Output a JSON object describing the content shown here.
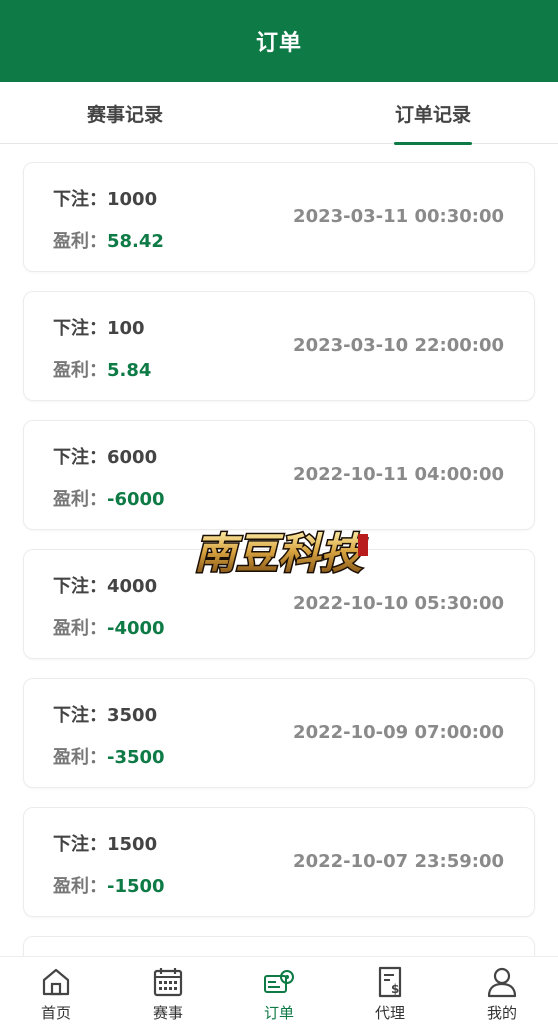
{
  "header": {
    "title": "订单"
  },
  "tabs": [
    {
      "label": "赛事记录",
      "active": false
    },
    {
      "label": "订单记录",
      "active": true
    }
  ],
  "orders": [
    {
      "bet_label": "下注：",
      "bet": "1000",
      "profit_label": "盈利：",
      "profit": "58.42",
      "time": "2023-03-11 00:30:00"
    },
    {
      "bet_label": "下注：",
      "bet": "100",
      "profit_label": "盈利：",
      "profit": "5.84",
      "time": "2023-03-10 22:00:00"
    },
    {
      "bet_label": "下注：",
      "bet": "6000",
      "profit_label": "盈利：",
      "profit": "-6000",
      "time": "2022-10-11 04:00:00"
    },
    {
      "bet_label": "下注：",
      "bet": "4000",
      "profit_label": "盈利：",
      "profit": "-4000",
      "time": "2022-10-10 05:30:00"
    },
    {
      "bet_label": "下注：",
      "bet": "3500",
      "profit_label": "盈利：",
      "profit": "-3500",
      "time": "2022-10-09 07:00:00"
    },
    {
      "bet_label": "下注：",
      "bet": "1500",
      "profit_label": "盈利：",
      "profit": "-1500",
      "time": "2022-10-07 23:59:00"
    }
  ],
  "watermark": {
    "text": "南豆科技"
  },
  "tabbar": [
    {
      "label": "首页",
      "icon": "home-icon"
    },
    {
      "label": "赛事",
      "icon": "calendar-icon"
    },
    {
      "label": "订单",
      "icon": "order-icon",
      "active": true
    },
    {
      "label": "代理",
      "icon": "agent-doc-icon"
    },
    {
      "label": "我的",
      "icon": "user-icon"
    }
  ],
  "colors": {
    "brand": "#0e7a45",
    "profit": "#0e7a45",
    "time": "#8a8a8a"
  }
}
